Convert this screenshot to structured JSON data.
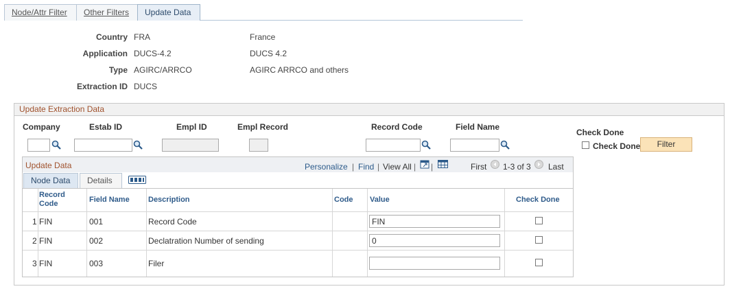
{
  "tabs": [
    "Node/Attr Filter",
    "Other Filters",
    "Update Data"
  ],
  "header": {
    "country_label": "Country",
    "country_code": "FRA",
    "country_name": "France",
    "application_label": "Application",
    "application_code": "DUCS-4.2",
    "application_name": "DUCS 4.2",
    "type_label": "Type",
    "type_code": "AGIRC/ARRCO",
    "type_name": "AGIRC ARRCO and others",
    "extraction_label": "Extraction ID",
    "extraction_value": "DUCS"
  },
  "group": {
    "title": "Update Extraction Data",
    "company_label": "Company",
    "estab_label": "Estab ID",
    "empl_id_label": "Empl ID",
    "empl_record_label": "Empl Record",
    "record_code_label": "Record Code",
    "field_name_label": "Field Name",
    "check_done_header": "Check Done",
    "check_done_label": "Check Done",
    "filter_button": "Filter"
  },
  "grid": {
    "title": "Update Data",
    "personalize": "Personalize",
    "find": "Find",
    "view_all": "View All",
    "first": "First",
    "range": "1-3 of 3",
    "last": "Last",
    "subtabs": [
      "Node Data",
      "Details"
    ],
    "columns": [
      "Record Code",
      "Field Name",
      "Description",
      "Code",
      "Value",
      "Check Done"
    ],
    "rows": [
      {
        "num": "1",
        "record_code": "FIN",
        "field_name": "001",
        "description": "Record Code",
        "code": "",
        "value": "FIN"
      },
      {
        "num": "2",
        "record_code": "FIN",
        "field_name": "002",
        "description": "Declatration Number of sending",
        "code": "",
        "value": "0"
      },
      {
        "num": "3",
        "record_code": "FIN",
        "field_name": "003",
        "description": "Filer",
        "code": "",
        "value": ""
      }
    ]
  },
  "icons": {
    "lookup": "magnifier-icon",
    "zoom": "new-window-icon",
    "download": "grid-download-icon",
    "prev": "left-arrow-icon",
    "next": "right-arrow-icon",
    "show_all_columns": "show-all-columns-icon"
  }
}
